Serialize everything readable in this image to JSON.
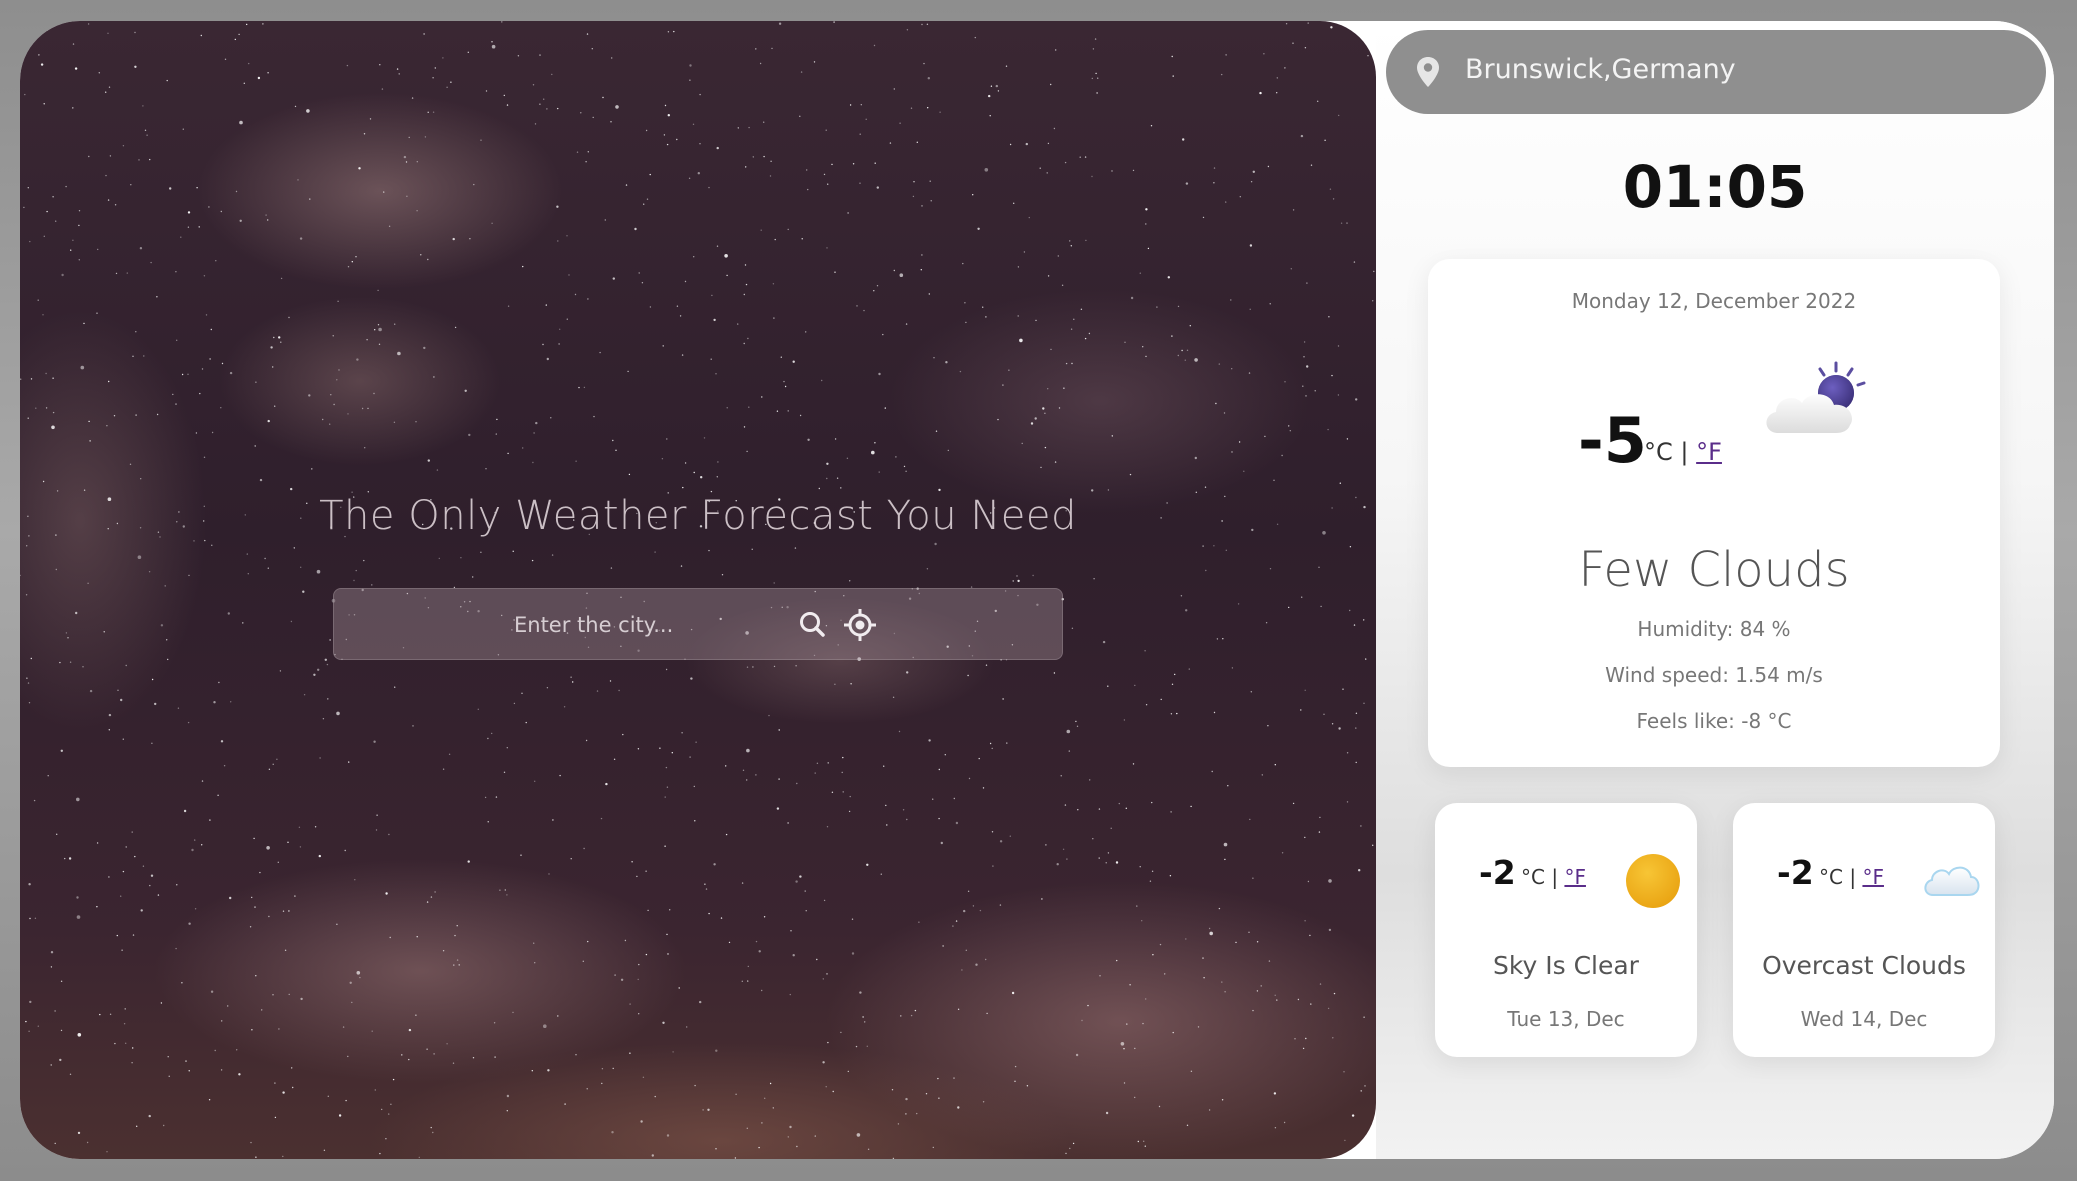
{
  "hero": {
    "title": "The Only Weather Forecast You Need",
    "search_placeholder": "Enter the city..."
  },
  "location": "Brunswick,Germany",
  "clock": "01:05",
  "current": {
    "date": "Monday 12, December 2022",
    "temp": "-5",
    "unit_c": "°C",
    "separator": "|",
    "unit_f": "°F",
    "condition": "Few Clouds",
    "humidity": "Humidity: 84 %",
    "wind": "Wind speed: 1.54 m/s",
    "feels_like": "Feels like: -8 °C",
    "icon": "few-clouds-night-icon"
  },
  "forecast": [
    {
      "temp": "-2",
      "unit_c": "°C",
      "separator": "|",
      "unit_f": "°F",
      "condition": "Sky Is Clear",
      "date": "Tue 13, Dec",
      "icon": "sun-icon"
    },
    {
      "temp": "-2",
      "unit_c": "°C",
      "separator": "|",
      "unit_f": "°F",
      "condition": "Overcast Clouds",
      "date": "Wed 14, Dec",
      "icon": "cloud-icon"
    }
  ],
  "colors": {
    "accent_link": "#5a2d8a",
    "pill": "#8f8f8f",
    "sun": "#f0b21b"
  }
}
